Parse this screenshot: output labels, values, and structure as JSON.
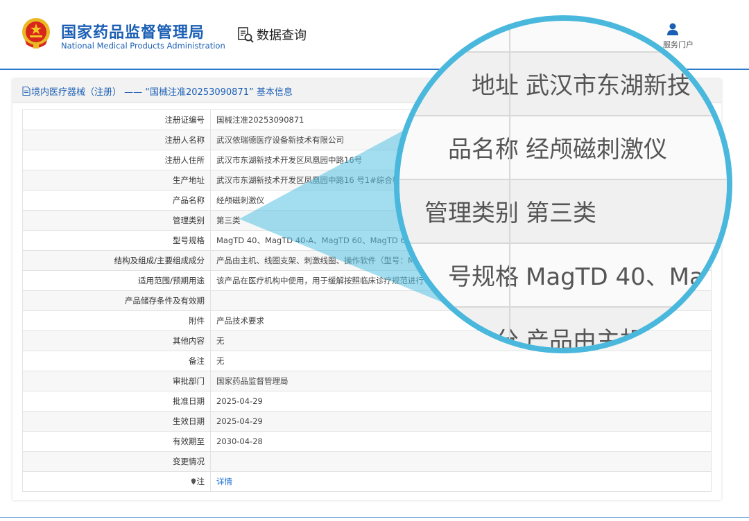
{
  "header": {
    "brand_cn": "国家药品监督管理局",
    "brand_en": "National Medical Products Administration",
    "query_label": "数据查询",
    "portal_label": "服务门户"
  },
  "panel": {
    "title": "境内医疗器械（注册） —— “国械注准20253090871” 基本信息"
  },
  "rows": [
    {
      "key": "注册证编号",
      "value": "国械注准20253090871"
    },
    {
      "key": "注册人名称",
      "value": "武汉依瑞德医疗设备新技术有限公司"
    },
    {
      "key": "注册人住所",
      "value": "武汉市东湖新技术开发区凤凰园中路16号"
    },
    {
      "key": "生产地址",
      "value": "武汉市东湖新技术开发区凤凰园中路16 号1#综合楼"
    },
    {
      "key": "产品名称",
      "value": "经颅磁刺激仪"
    },
    {
      "key": "管理类别",
      "value": "第三类"
    },
    {
      "key": "型号规格",
      "value": "MagTD 40、MagTD 40-A、MagTD 60、MagTD 6"
    },
    {
      "key": "结构及组成/主要组成成分",
      "value": "产品由主机、线圈支架、刺激线圈、操作软件（型号：M"
    },
    {
      "key": "适用范围/预期用途",
      "value": "该产品在医疗机构中使用，用于缓解按照临床诊疗规范进行"
    },
    {
      "key": "产品储存条件及有效期",
      "value": ""
    },
    {
      "key": "附件",
      "value": "产品技术要求"
    },
    {
      "key": "其他内容",
      "value": "无"
    },
    {
      "key": "备注",
      "value": "无"
    },
    {
      "key": "审批部门",
      "value": "国家药品监督管理局"
    },
    {
      "key": "批准日期",
      "value": "2025-04-29"
    },
    {
      "key": "生效日期",
      "value": "2025-04-29"
    },
    {
      "key": "有效期至",
      "value": "2030-04-28"
    },
    {
      "key": "变更情况",
      "value": ""
    },
    {
      "key": "注",
      "value": "详情"
    }
  ],
  "magnifier": {
    "rows": [
      {
        "key": "地址",
        "value": "武汉市东湖新技"
      },
      {
        "key": "品名称",
        "value": "经颅磁刺激仪"
      },
      {
        "key": "管理类别",
        "value": "第三类"
      },
      {
        "key": "号规格",
        "value": "MagTD 40、Ma"
      },
      {
        "key": "分",
        "value": "产品由主机"
      }
    ]
  },
  "colors": {
    "brand": "#1b5fb5",
    "accent_line": "#2a79c9",
    "magnifier_ring": "#4ab8dc",
    "link": "#1b6fd0"
  },
  "icons": [
    "national-emblem-icon",
    "data-query-icon",
    "user-icon",
    "document-icon",
    "pin-icon"
  ]
}
